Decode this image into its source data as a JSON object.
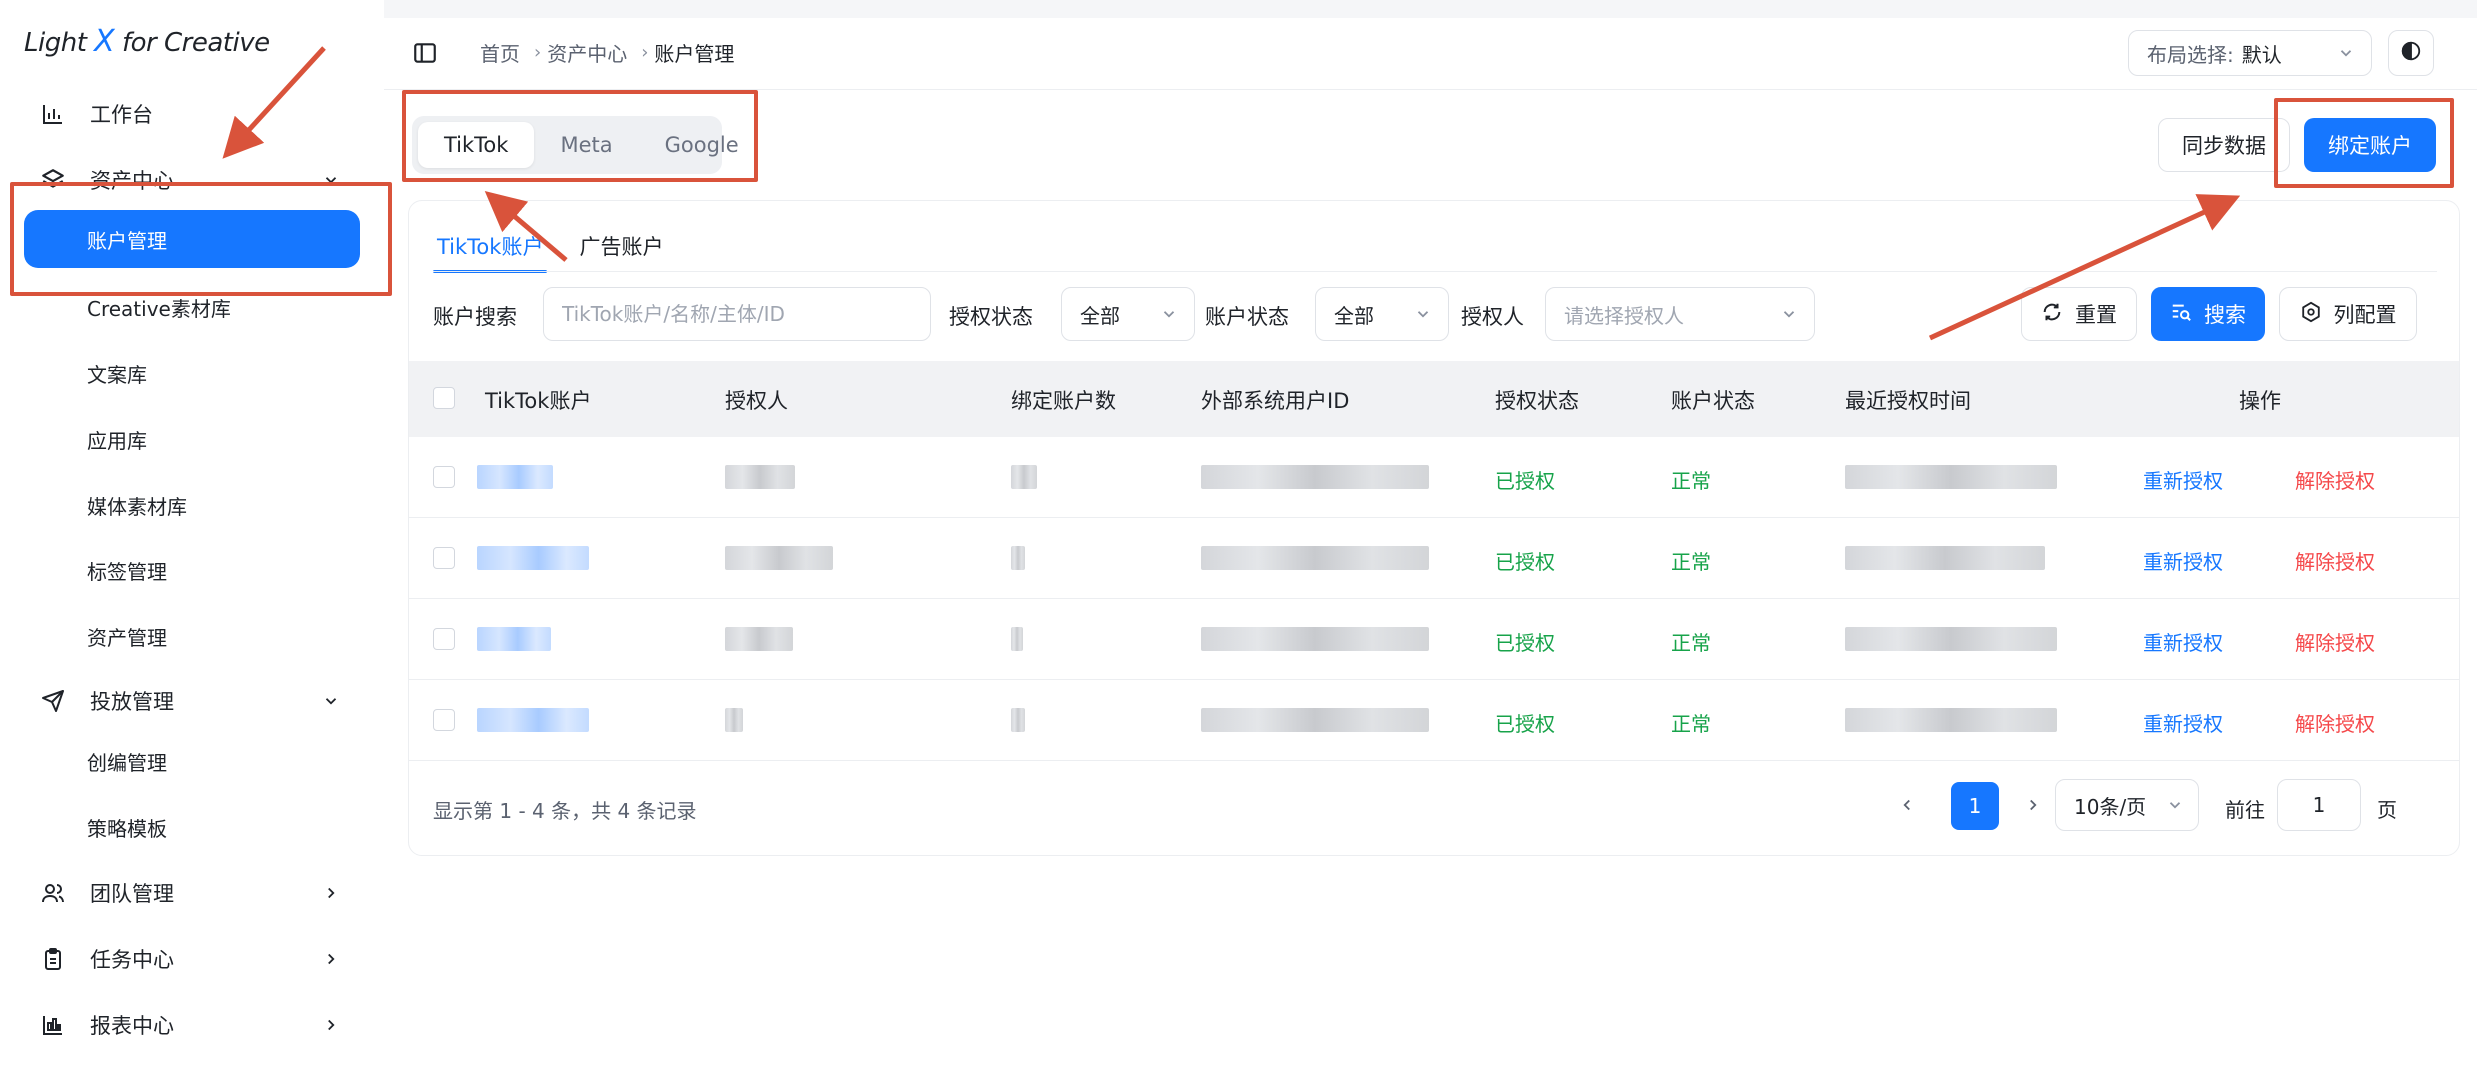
{
  "app": {
    "logo_prefix": "Light ",
    "logo_x": "X",
    "logo_suffix": " for Creative"
  },
  "sidebar": {
    "items": [
      {
        "label": "工作台",
        "icon": "bar-chart-icon"
      },
      {
        "label": "资产中心",
        "icon": "layers-icon",
        "expanded": true
      },
      {
        "label": "账户管理",
        "sub": true,
        "active": true
      },
      {
        "label": "Creative素材库",
        "sub": true
      },
      {
        "label": "文案库",
        "sub": true
      },
      {
        "label": "应用库",
        "sub": true
      },
      {
        "label": "媒体素材库",
        "sub": true
      },
      {
        "label": "标签管理",
        "sub": true
      },
      {
        "label": "资产管理",
        "sub": true
      },
      {
        "label": "投放管理",
        "icon": "send-icon",
        "expanded": true
      },
      {
        "label": "创编管理",
        "sub": true
      },
      {
        "label": "策略模板",
        "sub": true
      },
      {
        "label": "团队管理",
        "icon": "users-icon"
      },
      {
        "label": "任务中心",
        "icon": "clipboard-icon"
      },
      {
        "label": "报表中心",
        "icon": "report-icon"
      }
    ]
  },
  "header": {
    "breadcrumb": [
      "首页",
      "资产中心",
      "账户管理"
    ],
    "layout_label": "布局选择:",
    "layout_value": "默认"
  },
  "platform_tabs": [
    "TikTok",
    "Meta",
    "Google"
  ],
  "actions": {
    "sync": "同步数据",
    "bind": "绑定账户"
  },
  "sub_tabs": [
    "TikTok账户",
    "广告账户"
  ],
  "filters": {
    "search_label": "账户搜索",
    "search_placeholder": "TikTok账户/名称/主体/ID",
    "auth_status_label": "授权状态",
    "auth_status_value": "全部",
    "account_status_label": "账户状态",
    "account_status_value": "全部",
    "authorizer_label": "授权人",
    "authorizer_placeholder": "请选择授权人",
    "reset": "重置",
    "search": "搜索",
    "columns": "列配置"
  },
  "table": {
    "columns": [
      "TikTok账户",
      "授权人",
      "绑定账户数",
      "外部系统用户ID",
      "授权状态",
      "账户状态",
      "最近授权时间",
      "操作"
    ],
    "rows": [
      {
        "auth_status": "已授权",
        "account_status": "正常",
        "reauth": "重新授权",
        "revoke": "解除授权"
      },
      {
        "auth_status": "已授权",
        "account_status": "正常",
        "reauth": "重新授权",
        "revoke": "解除授权"
      },
      {
        "auth_status": "已授权",
        "account_status": "正常",
        "reauth": "重新授权",
        "revoke": "解除授权"
      },
      {
        "auth_status": "已授权",
        "account_status": "正常",
        "reauth": "重新授权",
        "revoke": "解除授权"
      }
    ]
  },
  "pagination": {
    "info": "显示第 1 - 4 条，共 4 条记录",
    "current": "1",
    "page_size": "10条/页",
    "goto_label": "前往",
    "goto_value": "1",
    "page_label": "页"
  },
  "colors": {
    "accent": "#1677ff",
    "success": "#17a34a",
    "danger": "#f5484a",
    "annotation": "#d9533b"
  }
}
